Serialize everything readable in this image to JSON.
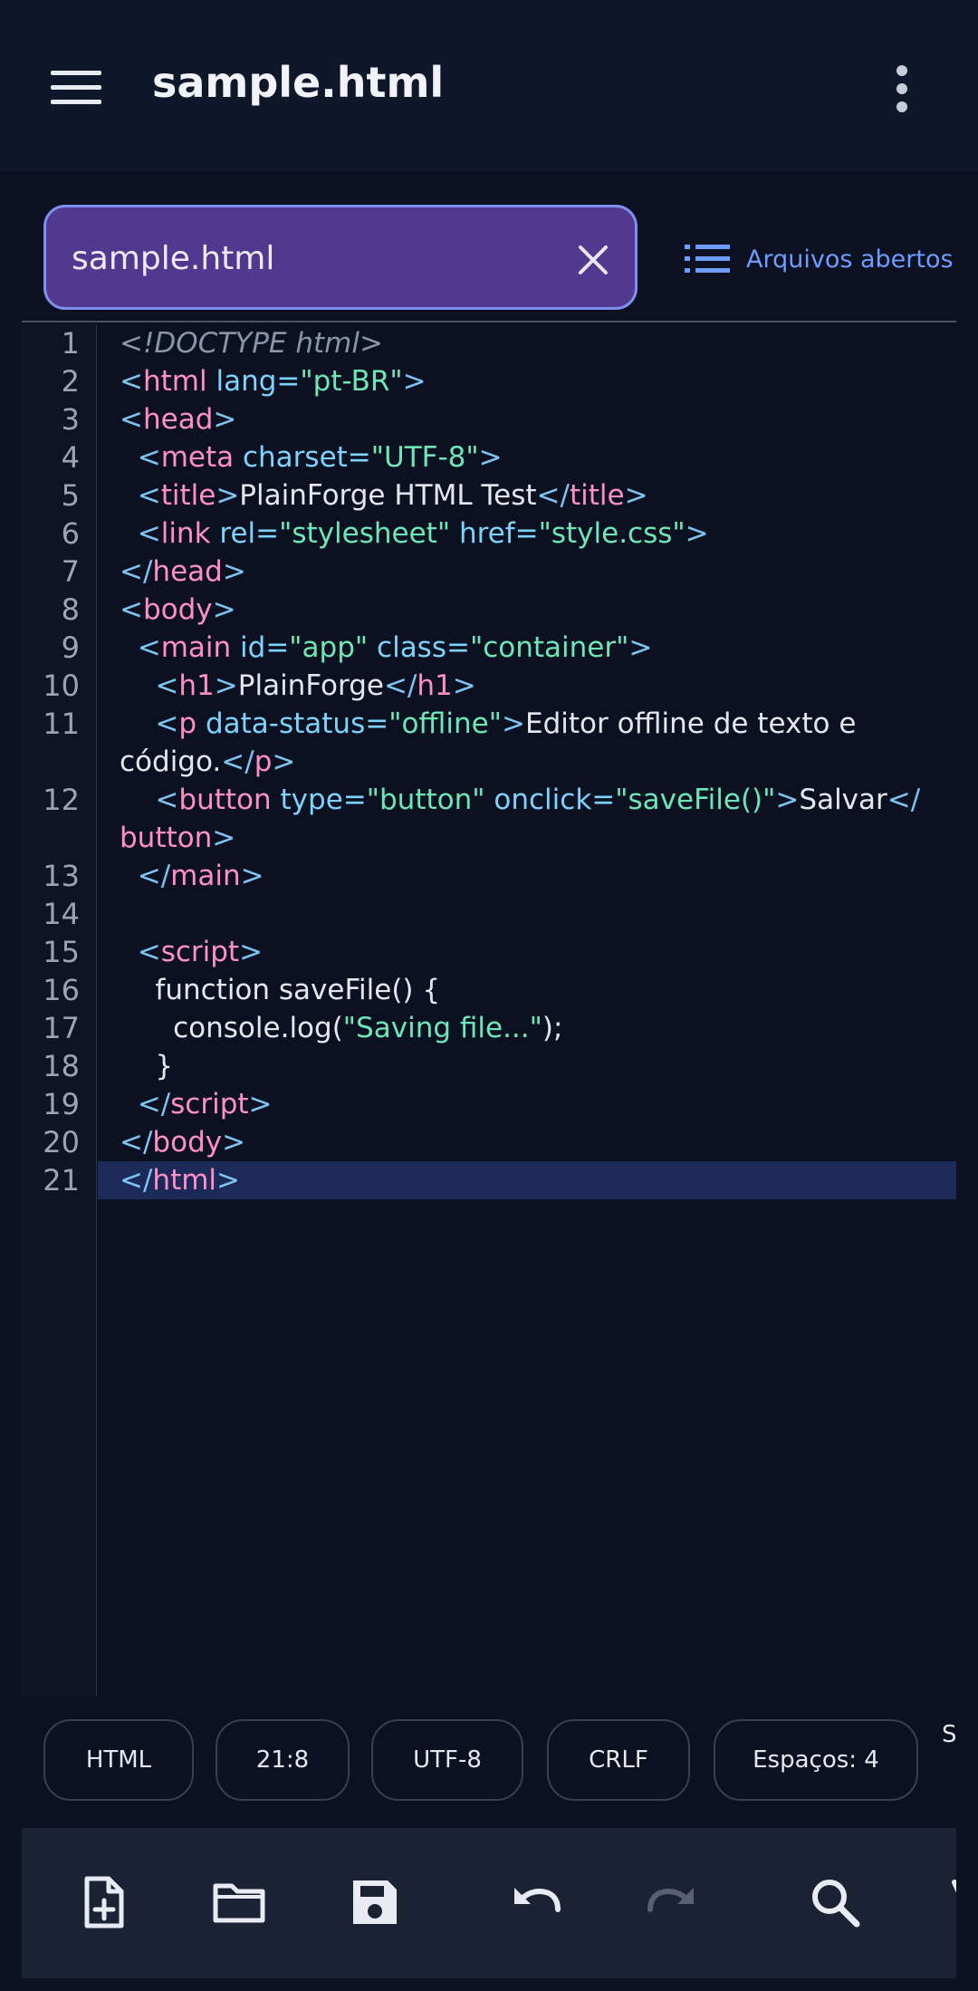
{
  "appbar": {
    "title": "sample.html"
  },
  "tab": {
    "label": "sample.html",
    "open_files_label": "Arquivos abertos"
  },
  "editor": {
    "highlighted_line": 21
  },
  "status": {
    "chips": [
      "HTML",
      "21:8",
      "UTF-8",
      "CRLF",
      "Espaços: 4"
    ],
    "overflow": "S"
  },
  "toolbar": {
    "icons": [
      "new-file-icon",
      "folder-icon",
      "save-icon",
      "undo-icon",
      "redo-icon",
      "search-icon"
    ]
  },
  "colors": {
    "tab_fill": "#523990",
    "tab_border": "#7f8ff0",
    "accent": "#6d9dff",
    "tag": "#ff8fc7",
    "string": "#6ee7b7",
    "attr": "#7dd3fc"
  },
  "code_lines": [
    [
      [
        "cm",
        "<!DOCTYPE html>"
      ]
    ],
    [
      [
        "br",
        "<"
      ],
      [
        "tag",
        "html"
      ],
      [
        "tx",
        " "
      ],
      [
        "attr",
        "lang="
      ],
      [
        "str",
        "\"pt-BR\""
      ],
      [
        "br",
        ">"
      ]
    ],
    [
      [
        "br",
        "<"
      ],
      [
        "tag",
        "head"
      ],
      [
        "br",
        ">"
      ]
    ],
    [
      [
        "tx",
        "  "
      ],
      [
        "br",
        "<"
      ],
      [
        "tag",
        "meta"
      ],
      [
        "tx",
        " "
      ],
      [
        "attr",
        "charset="
      ],
      [
        "str",
        "\"UTF-8\""
      ],
      [
        "br",
        ">"
      ]
    ],
    [
      [
        "tx",
        "  "
      ],
      [
        "br",
        "<"
      ],
      [
        "tag",
        "title"
      ],
      [
        "br",
        ">"
      ],
      [
        "tx",
        "PlainForge HTML Test"
      ],
      [
        "br",
        "</"
      ],
      [
        "tag",
        "title"
      ],
      [
        "br",
        ">"
      ]
    ],
    [
      [
        "tx",
        "  "
      ],
      [
        "br",
        "<"
      ],
      [
        "tag",
        "link"
      ],
      [
        "tx",
        " "
      ],
      [
        "attr",
        "rel="
      ],
      [
        "str",
        "\"stylesheet\""
      ],
      [
        "tx",
        " "
      ],
      [
        "attr",
        "href="
      ],
      [
        "str",
        "\"style.css\""
      ],
      [
        "br",
        ">"
      ]
    ],
    [
      [
        "br",
        "</"
      ],
      [
        "tag",
        "head"
      ],
      [
        "br",
        ">"
      ]
    ],
    [
      [
        "br",
        "<"
      ],
      [
        "tag",
        "body"
      ],
      [
        "br",
        ">"
      ]
    ],
    [
      [
        "tx",
        "  "
      ],
      [
        "br",
        "<"
      ],
      [
        "tag",
        "main"
      ],
      [
        "tx",
        " "
      ],
      [
        "attr",
        "id="
      ],
      [
        "str",
        "\"app\""
      ],
      [
        "tx",
        " "
      ],
      [
        "attr",
        "class="
      ],
      [
        "str",
        "\"container\""
      ],
      [
        "br",
        ">"
      ]
    ],
    [
      [
        "tx",
        "    "
      ],
      [
        "br",
        "<"
      ],
      [
        "tag",
        "h1"
      ],
      [
        "br",
        ">"
      ],
      [
        "tx",
        "PlainForge"
      ],
      [
        "br",
        "</"
      ],
      [
        "tag",
        "h1"
      ],
      [
        "br",
        ">"
      ]
    ],
    [
      [
        "tx",
        "    "
      ],
      [
        "br",
        "<"
      ],
      [
        "tag",
        "p"
      ],
      [
        "tx",
        " "
      ],
      [
        "attr",
        "data-status="
      ],
      [
        "str",
        "\"offline\""
      ],
      [
        "br",
        ">"
      ],
      [
        "tx",
        "Editor offline de texto e"
      ]
    ],
    [
      [
        "tx",
        "código."
      ],
      [
        "br",
        "</"
      ],
      [
        "tag",
        "p"
      ],
      [
        "br",
        ">"
      ]
    ],
    [
      [
        "tx",
        "    "
      ],
      [
        "br",
        "<"
      ],
      [
        "tag",
        "button"
      ],
      [
        "tx",
        " "
      ],
      [
        "attr",
        "type="
      ],
      [
        "str",
        "\"button\""
      ],
      [
        "tx",
        " "
      ],
      [
        "attr",
        "onclick="
      ],
      [
        "str",
        "\"saveFile()\""
      ],
      [
        "br",
        ">"
      ],
      [
        "tx",
        "Salvar"
      ],
      [
        "br",
        "</"
      ]
    ],
    [
      [
        "tag",
        "button"
      ],
      [
        "br",
        ">"
      ]
    ],
    [
      [
        "tx",
        "  "
      ],
      [
        "br",
        "</"
      ],
      [
        "tag",
        "main"
      ],
      [
        "br",
        ">"
      ]
    ],
    [],
    [
      [
        "tx",
        "  "
      ],
      [
        "br",
        "<"
      ],
      [
        "tag",
        "script"
      ],
      [
        "br",
        ">"
      ]
    ],
    [
      [
        "tx",
        "    function saveFile() {"
      ]
    ],
    [
      [
        "tx",
        "      console.log("
      ],
      [
        "str",
        "\"Saving file...\""
      ],
      [
        "tx",
        ");"
      ]
    ],
    [
      [
        "tx",
        "    }"
      ]
    ],
    [
      [
        "tx",
        "  "
      ],
      [
        "br",
        "</"
      ],
      [
        "tag",
        "script"
      ],
      [
        "br",
        ">"
      ]
    ],
    [
      [
        "br",
        "</"
      ],
      [
        "tag",
        "body"
      ],
      [
        "br",
        ">"
      ]
    ],
    [
      [
        "br",
        "</"
      ],
      [
        "tag",
        "html"
      ],
      [
        "br",
        ">"
      ]
    ]
  ],
  "line_numbers": [
    "1",
    "2",
    "3",
    "4",
    "5",
    "6",
    "7",
    "8",
    "9",
    "10",
    "11",
    "",
    "12",
    "",
    "13",
    "14",
    "15",
    "16",
    "17",
    "18",
    "19",
    "20",
    "21"
  ]
}
